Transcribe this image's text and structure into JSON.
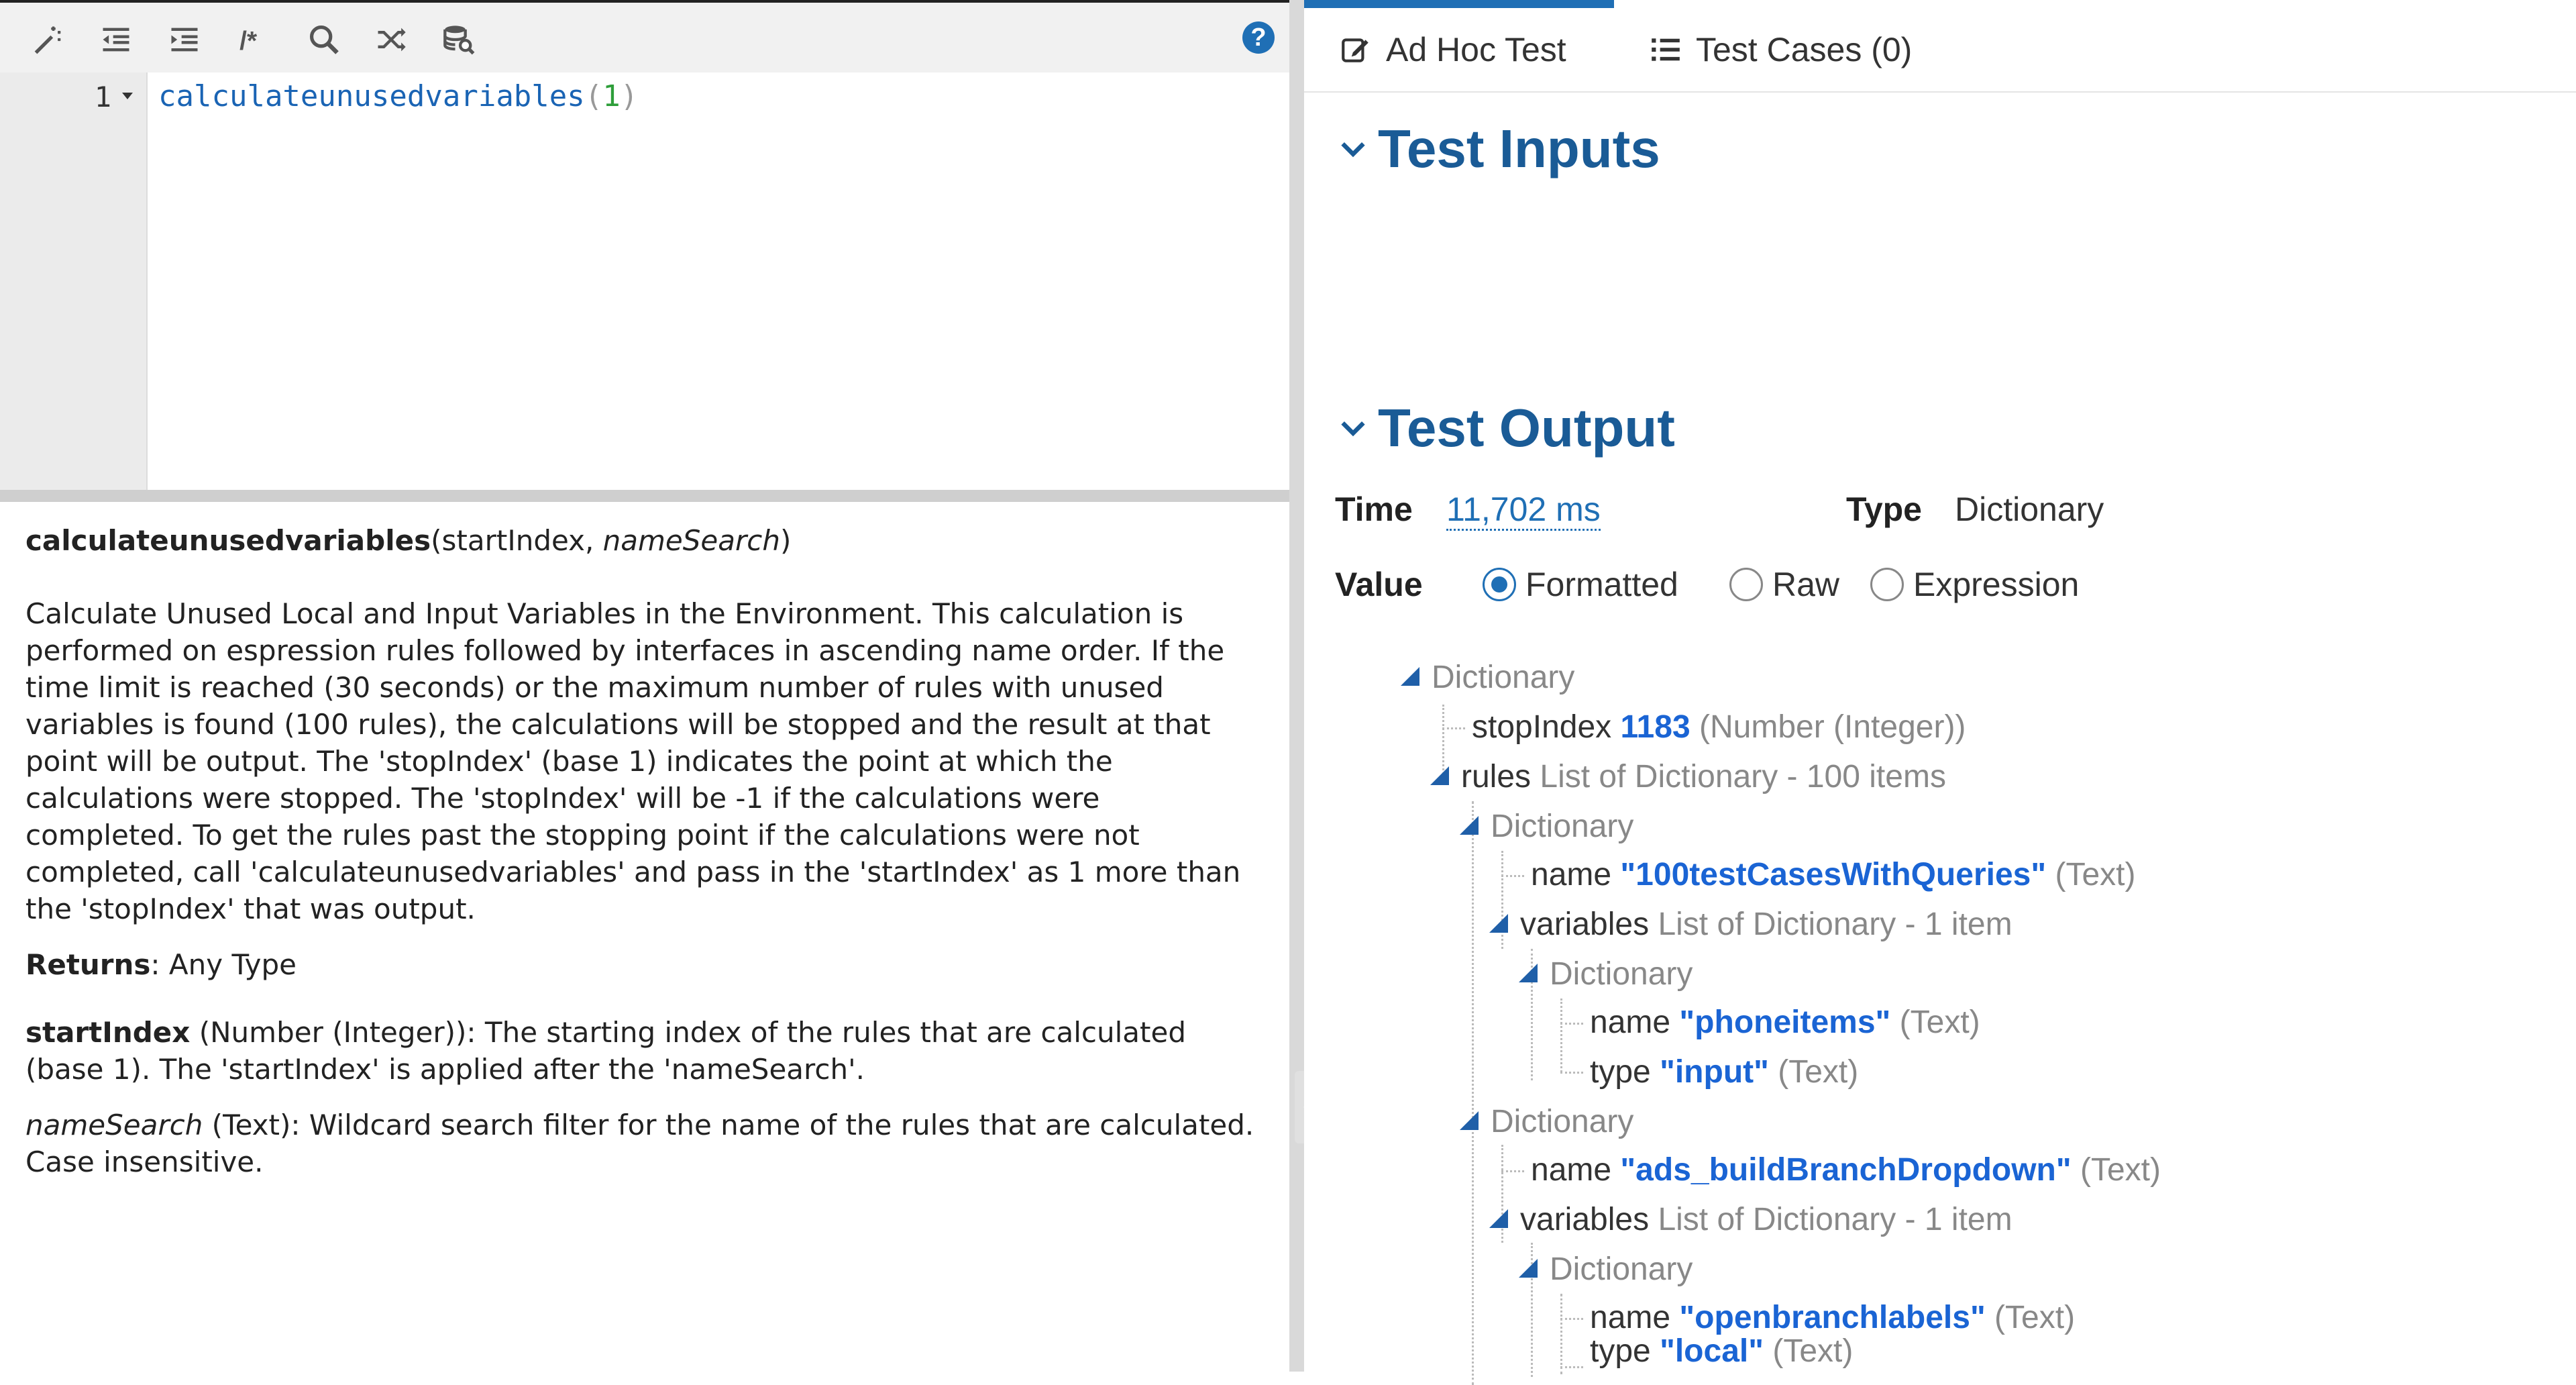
{
  "editor": {
    "line_number": "1",
    "code": {
      "fn": "calculateunusedvariables",
      "open": "(",
      "arg": "1",
      "close": ")"
    }
  },
  "toolbar": {
    "icons": [
      "magic-wand-icon",
      "outdent-icon",
      "indent-icon",
      "comment-icon",
      "search-icon",
      "shuffle-icon",
      "database-search-icon"
    ],
    "help": "?"
  },
  "doc": {
    "sig_name": "calculateunusedvariables",
    "sig_open": "(startIndex, ",
    "sig_param2": "nameSearch",
    "sig_close": ")",
    "description": "Calculate Unused Local and Input Variables in the Environment. This calculation is performed on espression rules followed by interfaces in ascending name order. If the time limit is reached (30 seconds) or the maximum number of rules with unused variables is found (100 rules), the calculations will be stopped and the result at that point will be output. The 'stopIndex' (base 1) indicates the point at which the calculations were stopped. The 'stopIndex' will be -1 if the calculations were completed. To get the rules past the stopping point if the calculations were not completed, call 'calculateunusedvariables' and pass in the 'startIndex' as 1 more than the 'stopIndex' that was output.",
    "returns_label": "Returns",
    "returns_value": ": Any Type",
    "param1_name": "startIndex",
    "param1_desc": " (Number (Integer)): The starting index of the rules that are calculated (base 1). The 'startIndex' is applied after the 'nameSearch'.",
    "param2_name": "nameSearch",
    "param2_desc": " (Text): Wildcard search filter for the name of the rules that are calculated. Case insensitive."
  },
  "tabs": {
    "adhoc": "Ad Hoc Test",
    "cases": "Test Cases (0)"
  },
  "sections": {
    "inputs": "Test Inputs",
    "output": "Test Output"
  },
  "output": {
    "time_label": "Time",
    "time_value": "11,702 ms",
    "type_label": "Type",
    "type_value": "Dictionary",
    "value_label": "Value",
    "radios": [
      "Formatted",
      "Raw",
      "Expression"
    ],
    "selected_radio": "Formatted"
  },
  "tree": {
    "root": "Dictionary",
    "stop_key": "stopIndex",
    "stop_val": "1183",
    "stop_type": "(Number (Integer))",
    "rules_key": "rules",
    "rules_type": "List of Dictionary - 100 items",
    "d1": "Dictionary",
    "d1_name_key": "name",
    "d1_name_val": "\"100testCasesWithQueries\"",
    "d1_name_type": "(Text)",
    "d1_vars_key": "variables",
    "d1_vars_type": "List of Dictionary - 1 item",
    "d1v": "Dictionary",
    "d1v_name_key": "name",
    "d1v_name_val": "\"phoneitems\"",
    "d1v_name_type": "(Text)",
    "d1v_type_key": "type",
    "d1v_type_val": "\"input\"",
    "d1v_type_type": "(Text)",
    "d2": "Dictionary",
    "d2_name_key": "name",
    "d2_name_val": "\"ads_buildBranchDropdown\"",
    "d2_name_type": "(Text)",
    "d2_vars_key": "variables",
    "d2_vars_type": "List of Dictionary - 1 item",
    "d2v": "Dictionary",
    "d2v_name_key": "name",
    "d2v_name_val": "\"openbranchlabels\"",
    "d2v_name_type": "(Text)",
    "d2v_type_key": "type",
    "d2v_type_val": "\"local\"",
    "d2v_type_type": "(Text)"
  }
}
